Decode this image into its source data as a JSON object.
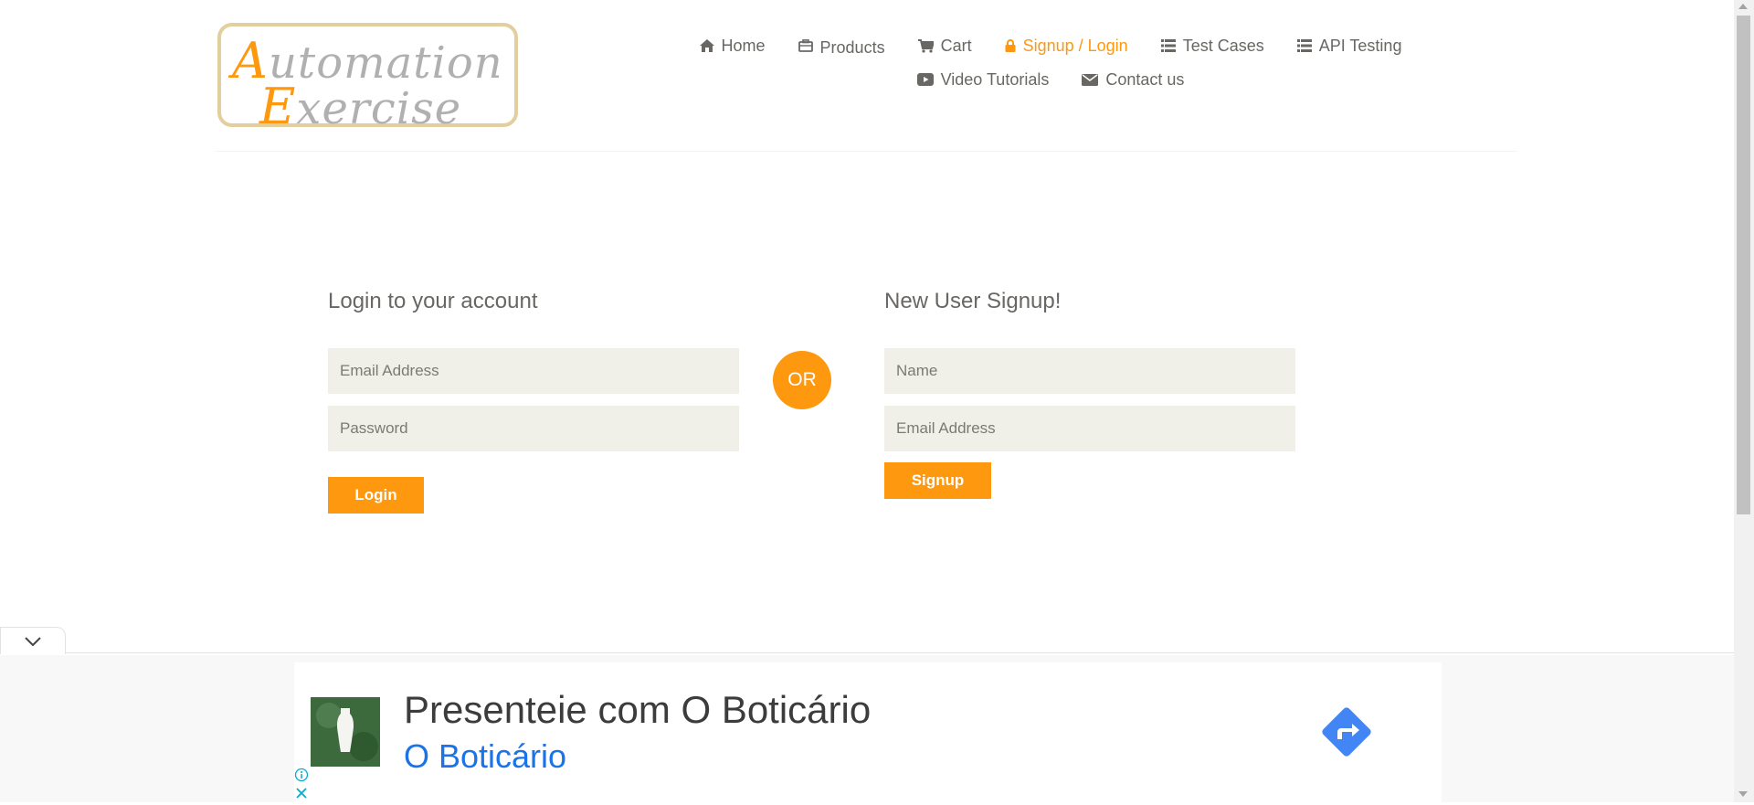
{
  "logo": {
    "line1_cap": "A",
    "line1_rest": "utomation",
    "line2_cap": "E",
    "line2_rest": "xercise"
  },
  "nav": {
    "items": [
      {
        "label": "Home",
        "icon": "home-icon"
      },
      {
        "label": "Products",
        "icon": "briefcase-icon"
      },
      {
        "label": "Cart",
        "icon": "cart-icon"
      },
      {
        "label": "Signup / Login",
        "icon": "lock-icon",
        "active": true
      },
      {
        "label": "Test Cases",
        "icon": "list-icon"
      },
      {
        "label": "API Testing",
        "icon": "list-icon"
      },
      {
        "label": "Video Tutorials",
        "icon": "youtube-play-icon"
      },
      {
        "label": "Contact us",
        "icon": "envelope-icon"
      }
    ]
  },
  "login": {
    "title": "Login to your account",
    "email_placeholder": "Email Address",
    "password_placeholder": "Password",
    "button": "Login"
  },
  "or_label": "OR",
  "signup": {
    "title": "New User Signup!",
    "name_placeholder": "Name",
    "email_placeholder": "Email Address",
    "button": "Signup"
  },
  "ad": {
    "title": "Presenteie com O Boticário",
    "advertiser": "O Boticário"
  },
  "colors": {
    "accent": "#fe980f",
    "text": "#696763",
    "field_bg": "#f0f0e9",
    "ad_link": "#1a73e8",
    "ad_arrow": "#4285f4"
  }
}
